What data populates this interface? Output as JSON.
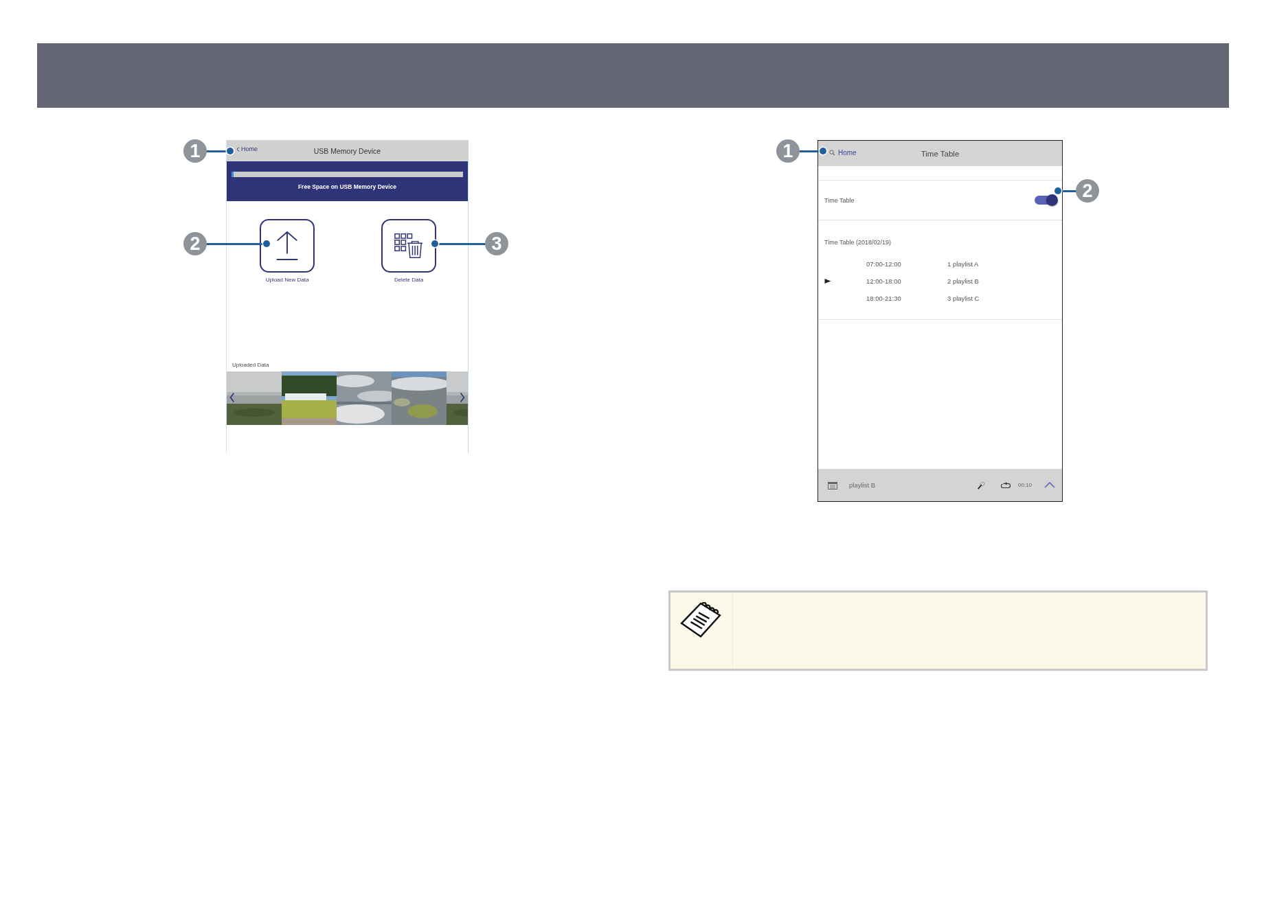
{
  "usb_screen": {
    "home_link": "Home",
    "title": "USB Memory Device",
    "free_space": {
      "level": 0.01,
      "label": "Free Space on USB Memory Device"
    },
    "actions": [
      {
        "kind": "upload",
        "label": "Upload New Data"
      },
      {
        "kind": "delete",
        "label": "Delete Data"
      }
    ],
    "uploaded_heading": "Uploaded Data",
    "callouts": [
      "1",
      "2",
      "3"
    ]
  },
  "time_table_screen": {
    "home_link": "Home",
    "title": "Time Table",
    "toggle": {
      "label": "Time Table",
      "on": true
    },
    "schedule_heading": "Time Table (2018/02/19)",
    "rows": [
      {
        "time": "07:00-12:00",
        "playlist": "1 playlist A",
        "playing": false
      },
      {
        "time": "12:00-18:00",
        "playlist": "2 playlist B",
        "playing": true
      },
      {
        "time": "18:00-21:30",
        "playlist": "3 playlist C",
        "playing": false
      }
    ],
    "player_bar": {
      "playlist": "playlist B",
      "duration": "00:10"
    },
    "callouts": [
      "1",
      "2"
    ]
  }
}
